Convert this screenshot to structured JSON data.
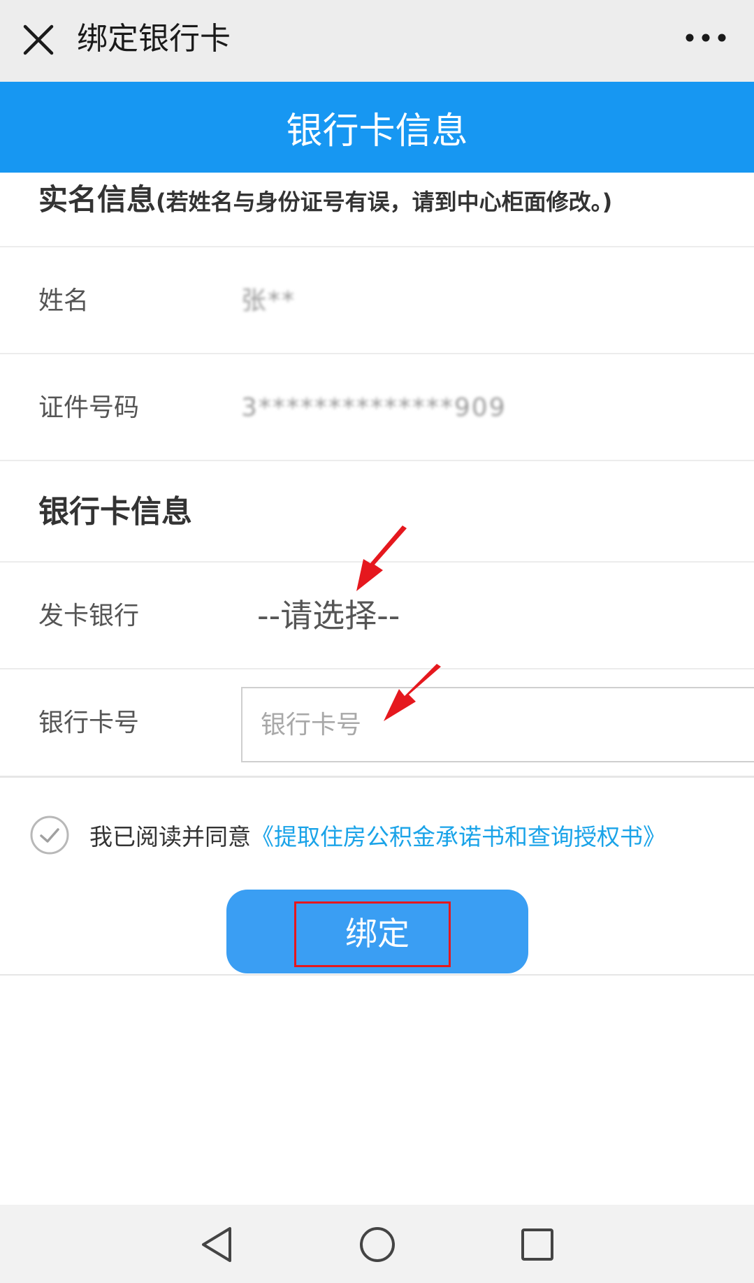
{
  "titlebar": {
    "title": "绑定银行卡",
    "close_icon": "close-icon",
    "more_icon": "more-dots-icon"
  },
  "header": {
    "title": "银行卡信息"
  },
  "notice": {
    "main": "实名信息",
    "detail": "(若姓名与身份证号有误，请到中心柜面修改。)"
  },
  "identity": {
    "name_label": "姓名",
    "name_value": "张**",
    "id_label": "证件号码",
    "id_value": "3**************909"
  },
  "bank_section": {
    "title": "银行卡信息",
    "bank_label": "发卡银行",
    "bank_value": "--请选择--",
    "card_label": "银行卡号",
    "card_placeholder": "银行卡号",
    "card_value": ""
  },
  "agreement": {
    "text": "我已阅读并同意",
    "link": "《提取住房公积金承诺书和查询授权书》",
    "checked": true
  },
  "bind_button": {
    "label": "绑定"
  },
  "colors": {
    "header_blue": "#1797f2",
    "button_blue": "#3a9ef3",
    "link_blue": "#1aa3e8",
    "annotation_red": "#e5181e"
  },
  "navbar": {
    "back_icon": "back-triangle-icon",
    "home_icon": "home-circle-icon",
    "recents_icon": "recents-square-icon"
  }
}
